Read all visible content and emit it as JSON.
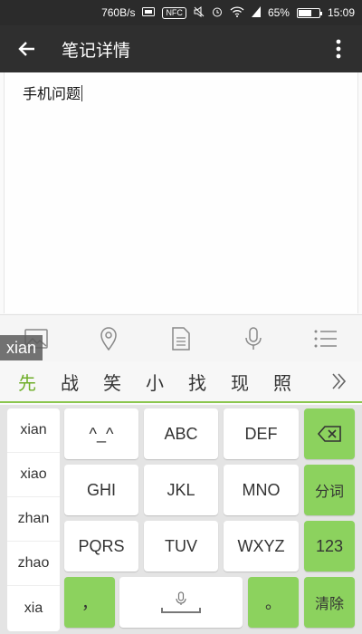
{
  "status_bar": {
    "speed": "760B/s",
    "nfc": "NFC",
    "battery_percent": "65%",
    "battery_level": 0.65,
    "time": "15:09"
  },
  "app_bar": {
    "title": "笔记详情",
    "back_icon": "arrow-left-icon",
    "more_icon": "more-vertical-icon"
  },
  "editor": {
    "text": "手机问题"
  },
  "toolbar": {
    "items": [
      "image-icon",
      "location-icon",
      "document-icon",
      "microphone-icon",
      "list-icon"
    ]
  },
  "composing": {
    "pinyin": "xian"
  },
  "candidates": {
    "items": [
      "先",
      "战",
      "笑",
      "小",
      "找",
      "现",
      "照"
    ],
    "more_icon": "chevron-right-double-icon"
  },
  "keyboard": {
    "pinyin_options": [
      "xian",
      "xiao",
      "zhan",
      "zhao",
      "xia"
    ],
    "keys": {
      "k1": "^_^",
      "k2": "ABC",
      "k3": "DEF",
      "k4": "GHI",
      "k5": "JKL",
      "k6": "MNO",
      "k7": "PQRS",
      "k8": "TUV",
      "k9": "WXYZ",
      "comma": "，",
      "period": "。",
      "fenci": "分词",
      "num": "123",
      "clear": "清除"
    },
    "accent_color": "#8cd25e"
  }
}
